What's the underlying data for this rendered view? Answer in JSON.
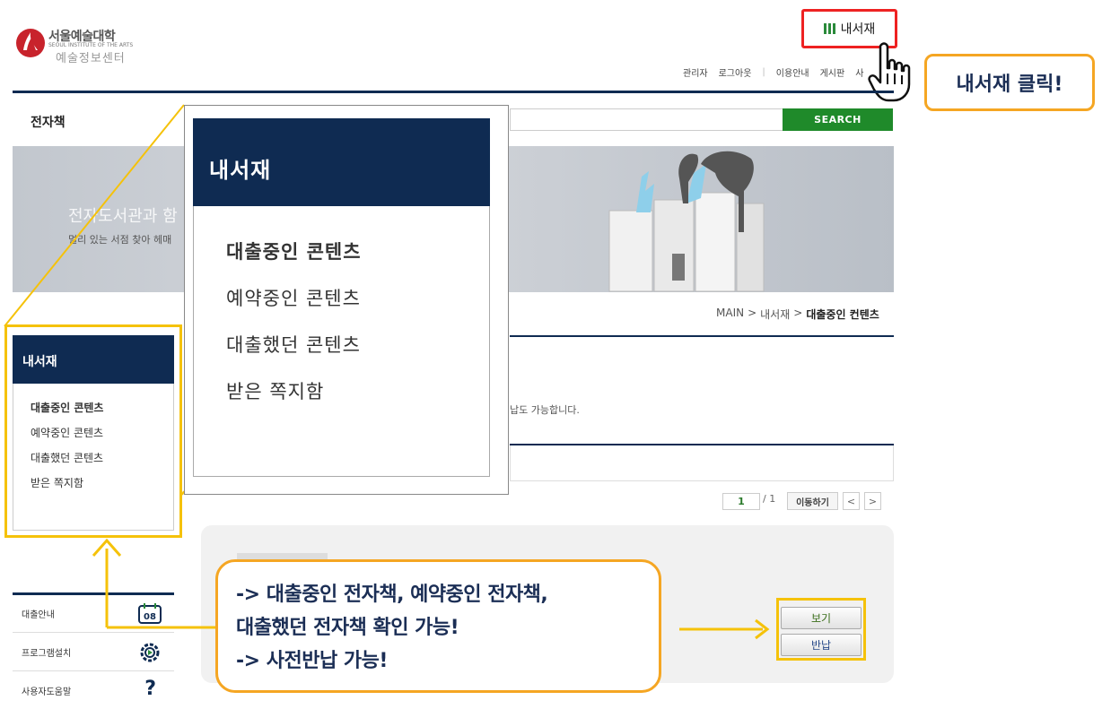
{
  "logo": {
    "name": "서울예술대학",
    "english": "SEOUL INSTITUTE OF THE ARTS",
    "center": "예술정보센터"
  },
  "header": {
    "mylib_button": "내서재",
    "topnav": [
      "관리자",
      "로그아웃",
      "이용안내",
      "게시판",
      "사"
    ]
  },
  "search": {
    "section_label": "전자책",
    "button": "SEARCH"
  },
  "banner": {
    "title": "전자도서관과 함",
    "subtitle": "멀리 있는 서점 찾아 헤매"
  },
  "breadcrumb": {
    "home": "MAIN",
    "sep": ">",
    "section": "내서재",
    "current": "대출중인 컨텐츠"
  },
  "notice": "납도 가능합니다.",
  "pager": {
    "current": "1",
    "total": "/ 1",
    "go": "이동하기",
    "prev": "<",
    "next": ">"
  },
  "actions": {
    "view": "보기",
    "return": "반납"
  },
  "sidebar": {
    "title": "내서재",
    "items": [
      "대출중인 콘텐츠",
      "예약중인 콘텐츠",
      "대출했던 콘텐츠",
      "받은 쪽지함"
    ]
  },
  "quick": [
    {
      "label": "대출안내",
      "icon": "calendar-icon",
      "badge": "08"
    },
    {
      "label": "프로그램설치",
      "icon": "gear-icon"
    },
    {
      "label": "사용자도움말",
      "icon": "question-icon",
      "glyph": "?"
    }
  ],
  "zoom": {
    "title": "내서재",
    "items": [
      "대출중인 콘텐츠",
      "예약중인 콘텐츠",
      "대출했던 콘텐츠",
      "받은 쪽지함"
    ]
  },
  "callouts": {
    "click": "내서재 클릭!",
    "info": [
      "-> 대출중인 전자책, 예약중인 전자책,",
      "대출했던 전자책 확인 가능!",
      "-> 사전반납 가능!"
    ]
  },
  "colors": {
    "navy": "#0f2b52",
    "search_green": "#1f8a2a",
    "highlight_yellow": "#f5c20a",
    "callout_orange": "#f5a623",
    "red_box": "#e22222"
  }
}
